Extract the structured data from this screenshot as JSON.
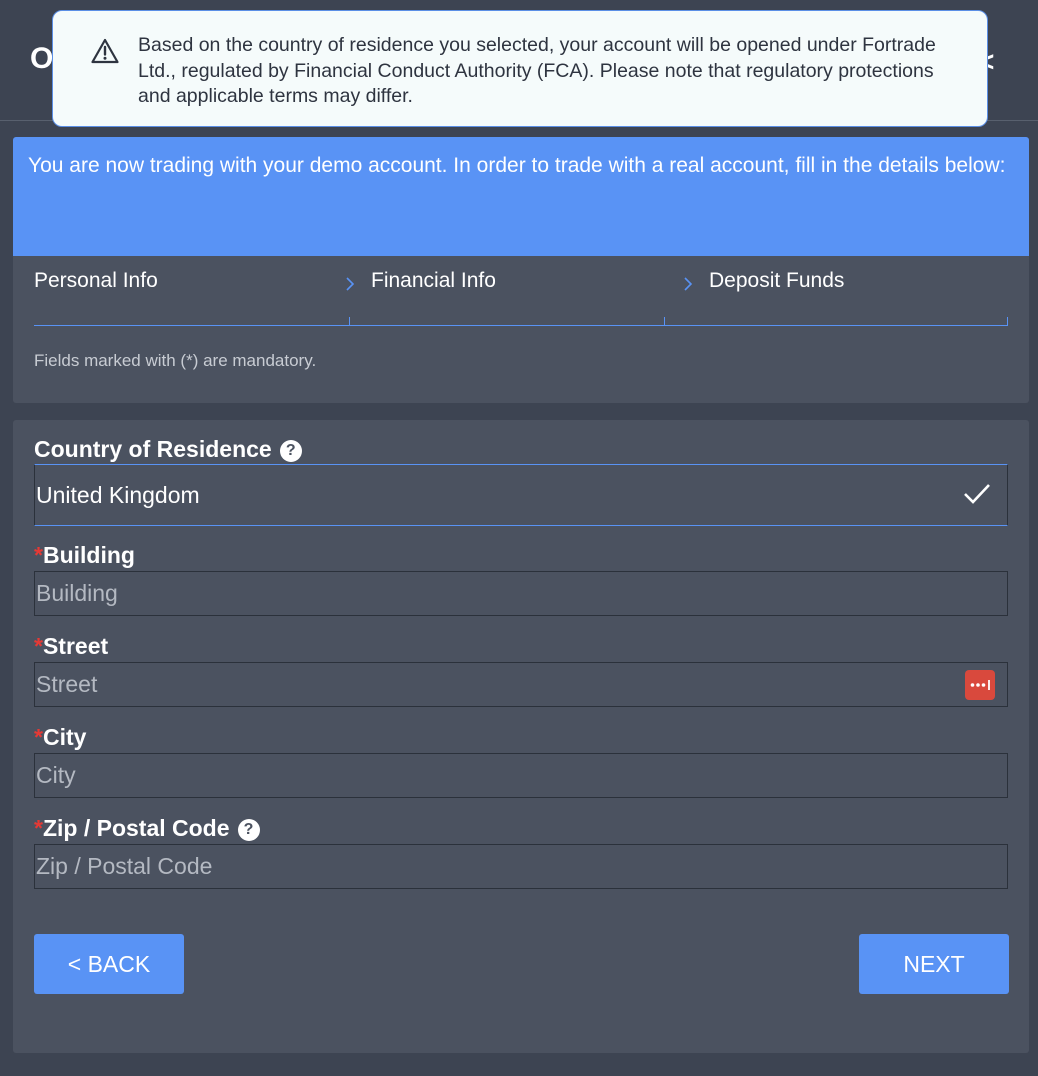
{
  "header": {
    "left_fragment": "O",
    "right_fragment": "<"
  },
  "notice": {
    "icon": "warning-triangle-icon",
    "text": "Based on the country of residence you selected, your account will be opened under Fortrade Ltd., regulated by Financial Conduct Authority (FCA). Please note that regulatory protections and applicable terms may differ."
  },
  "banner": {
    "text": "You are now trading with your demo account. In order to trade with a real account, fill in the details below:"
  },
  "steps": [
    "Personal Info",
    "Financial Info",
    "Deposit Funds"
  ],
  "mandatory_note": "Fields marked with (*) are mandatory.",
  "form": {
    "country": {
      "label": "Country of Residence",
      "help": "?",
      "value": "United Kingdom",
      "icon": "check-icon"
    },
    "building": {
      "required_mark": "*",
      "label": "Building",
      "placeholder": "Building"
    },
    "street": {
      "required_mark": "*",
      "label": "Street",
      "placeholder": "Street",
      "icon": "password-manager-dots-icon"
    },
    "city": {
      "required_mark": "*",
      "label": "City",
      "placeholder": "City"
    },
    "zip": {
      "required_mark": "*",
      "label": "Zip / Postal Code",
      "help": "?",
      "placeholder": "Zip / Postal Code"
    }
  },
  "buttons": {
    "back": "< BACK",
    "next": "NEXT"
  },
  "colors": {
    "accent": "#5993f5",
    "panel": "#4b5260",
    "background": "#3d4452",
    "required": "#e53935"
  }
}
